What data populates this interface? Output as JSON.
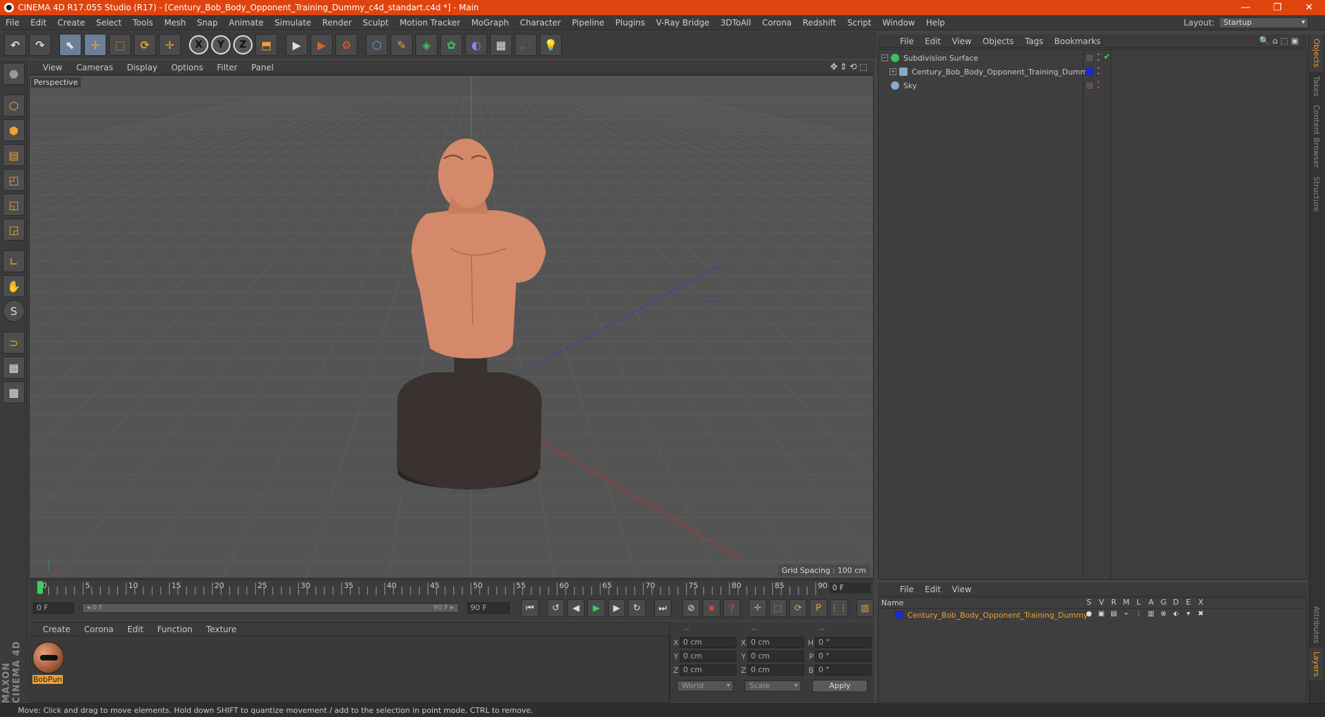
{
  "window": {
    "title": "CINEMA 4D R17.055 Studio (R17) - [Century_Bob_Body_Opponent_Training_Dummy_c4d_standart.c4d *] - Main",
    "controls": [
      "—",
      "❐",
      "✕"
    ]
  },
  "menubar": {
    "items": [
      "File",
      "Edit",
      "Create",
      "Select",
      "Tools",
      "Mesh",
      "Snap",
      "Animate",
      "Simulate",
      "Render",
      "Sculpt",
      "Motion Tracker",
      "MoGraph",
      "Character",
      "Pipeline",
      "Plugins",
      "V-Ray Bridge",
      "3DToAll",
      "Corona",
      "Redshift",
      "Script",
      "Window",
      "Help"
    ],
    "layout_label": "Layout:",
    "layout_value": "Startup"
  },
  "toolbar": {
    "undo_icon": "↶",
    "redo_icon": "↷",
    "select_icon": "⬉",
    "move_icon": "✛",
    "scale_icon": "⬚",
    "rotate_icon": "⟳",
    "transform_icon": "✛",
    "axis_x": "X",
    "axis_y": "Y",
    "axis_z": "Z",
    "coord_icon": "⬒",
    "render_view_icon": "▶",
    "render_icon": "▶",
    "render_settings_icon": "⚙",
    "cube_icon": "⬡",
    "pen_icon": "✎",
    "subdiv_icon": "◈",
    "cloner_icon": "✿",
    "deformer_icon": "◐",
    "floor_icon": "▦",
    "camera_icon": "🎥",
    "light_icon": "💡"
  },
  "lefttools": {
    "icons": [
      "⬣",
      "⬡",
      "⬢",
      "▤",
      "◰",
      "◱",
      "◲",
      "∟",
      "✋",
      "S",
      "⊃",
      "▦",
      "▩"
    ]
  },
  "viewport": {
    "menu": [
      "View",
      "Cameras",
      "Display",
      "Options",
      "Filter",
      "Panel"
    ],
    "nav_icons": "✥⇕⟲⬚",
    "camera_label": "Perspective",
    "grid_spacing": "Grid Spacing : 100 cm",
    "colors": {
      "background": "#545454",
      "skin": "#d4896a",
      "base": "#3a3230",
      "x_axis": "#c03030",
      "y_axis": "#30a030",
      "z_axis": "#3040c0"
    }
  },
  "timeline": {
    "ticks": [
      "0",
      "5",
      "10",
      "15",
      "20",
      "25",
      "30",
      "35",
      "40",
      "45",
      "50",
      "55",
      "60",
      "65",
      "70",
      "75",
      "80",
      "85",
      "90"
    ],
    "current_frame": "0 F",
    "start_field": "0 F",
    "range_start": "◂ 0 F",
    "range_end": "90 F ▸",
    "end_field": "90 F"
  },
  "transport": {
    "first_icon": "⏮",
    "prev_key_icon": "↺",
    "prev_icon": "◀",
    "play_icon": "▶",
    "next_icon": "▶",
    "next_key_icon": "↻",
    "last_icon": "⏭",
    "keys_icon": "⊘",
    "record_icon": "⏺",
    "auto_icon": "?",
    "pos_icon": "✛",
    "scale_icon": "⬚",
    "rot_icon": "⟳",
    "param_icon": "P",
    "pla_icon": "⋮⋮",
    "timeline_icon": "▥"
  },
  "material_manager": {
    "menu": [
      "Create",
      "Corona",
      "Edit",
      "Function",
      "Texture"
    ],
    "material_name": "BobPun"
  },
  "coordinates": {
    "headers": [
      "--",
      "--",
      "--"
    ],
    "rows": [
      {
        "l1": "X",
        "v1": "0 cm",
        "l2": "X",
        "v2": "0 cm",
        "l3": "H",
        "v3": "0 °"
      },
      {
        "l1": "Y",
        "v1": "0 cm",
        "l2": "Y",
        "v2": "0 cm",
        "l3": "P",
        "v3": "0 °"
      },
      {
        "l1": "Z",
        "v1": "0 cm",
        "l2": "Z",
        "v2": "0 cm",
        "l3": "B",
        "v3": "0 °"
      }
    ],
    "mode_world": "World",
    "mode_scale": "Scale",
    "apply_label": "Apply"
  },
  "status": {
    "text": "Move: Click and drag to move elements. Hold down SHIFT to quantize movement / add to the selection in point mode, CTRL to remove."
  },
  "object_manager": {
    "menu": [
      "File",
      "Edit",
      "View",
      "Objects",
      "Tags",
      "Bookmarks"
    ],
    "icons": "🔍⌂⬚▣",
    "objects": [
      {
        "name": "Subdivision Surface",
        "color": "#3ac060"
      },
      {
        "name": "Century_Bob_Body_Opponent_Training_Dummy",
        "color": "#88aacc"
      },
      {
        "name": "Sky",
        "color": "#88aacc"
      }
    ],
    "expand_minus": "−",
    "expand_plus": "+",
    "check": "✔"
  },
  "side_tabs": [
    "Objects",
    "Takes",
    "Content Browser",
    "Structure",
    "Attributes",
    "Layers"
  ],
  "layer_manager": {
    "menu": [
      "File",
      "Edit",
      "View"
    ],
    "name_header": "Name",
    "columns": [
      "S",
      "V",
      "R",
      "M",
      "L",
      "A",
      "G",
      "D",
      "E",
      "X"
    ],
    "layer_name": "Century_Bob_Body_Opponent_Training_Dummy",
    "layer_icons": [
      "●",
      "▣",
      "▤",
      "⌁",
      "⋮",
      "▥",
      "⊗",
      "⬖",
      "▾",
      "✖"
    ]
  }
}
